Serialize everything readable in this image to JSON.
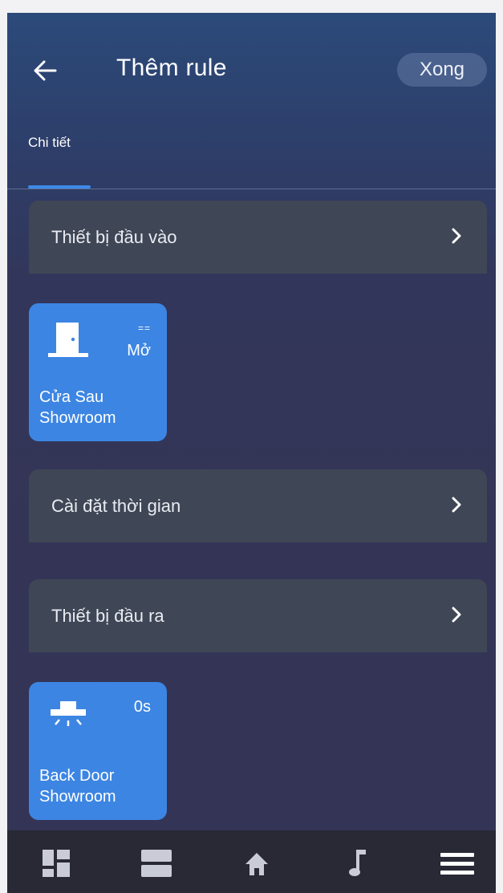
{
  "header": {
    "title": "Thêm rule",
    "done_label": "Xong"
  },
  "tabs": [
    {
      "label": "Chi tiết",
      "active": true
    }
  ],
  "sections": {
    "input": {
      "label": "Thiết bị đầu vào"
    },
    "time": {
      "label": "Cài đặt thời gian"
    },
    "output": {
      "label": "Thiết bị đầu ra"
    }
  },
  "input_device": {
    "name": "Cửa Sau Showroom",
    "operator": "==",
    "value": "Mở",
    "icon": "door-icon"
  },
  "output_device": {
    "name": "Back Door Showroom",
    "value": "0s",
    "icon": "ceiling-light-icon"
  },
  "bottom_nav": [
    {
      "name": "dashboard-icon"
    },
    {
      "name": "rooms-icon"
    },
    {
      "name": "home-icon"
    },
    {
      "name": "music-icon"
    },
    {
      "name": "menu-icon"
    }
  ],
  "colors": {
    "accent": "#3d8ae8",
    "card": "#3c85e3",
    "section": "#3f4655",
    "nav_bg": "#282935"
  }
}
